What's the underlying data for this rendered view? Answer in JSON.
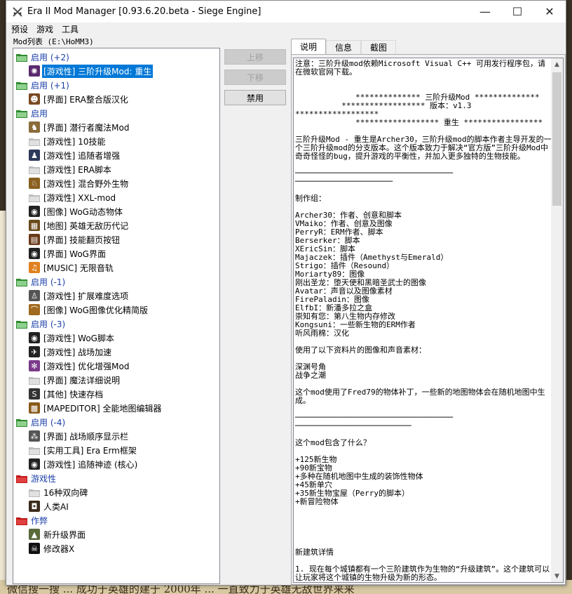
{
  "window": {
    "title": "Era II Mod Manager [0.93.6.20.beta - Siege Engine]",
    "controls": {
      "minimize": "—",
      "maximize": "☐",
      "close": "✕"
    }
  },
  "menu": [
    "预设",
    "游戏",
    "工具"
  ],
  "mod_list_label": "Mod列表 (E:\\HoMM3)",
  "tree": [
    {
      "kind": "group",
      "color": "#2e8b2e",
      "label": "启用 (+2)"
    },
    {
      "kind": "item",
      "icon": "gear-eye-icon",
      "iconColor": "#5b2a6e",
      "label": "[游戏性] 三阶升级Mod: 重生",
      "selected": true
    },
    {
      "kind": "group",
      "color": "#2e8b2e",
      "label": "启用 (+1)"
    },
    {
      "kind": "item",
      "icon": "hero-portrait-icon",
      "iconColor": "#7a4a22",
      "label": "[界面] ERA整合版汉化"
    },
    {
      "kind": "group",
      "color": "#2e8b2e",
      "label": "启用"
    },
    {
      "kind": "item",
      "icon": "creature-icon",
      "iconColor": "#8a6b3a",
      "label": "[界面] 潜行者魔法Mod"
    },
    {
      "kind": "item",
      "icon": "folder-icon",
      "iconColor": "#bdbdbd",
      "label": "[游戏性] 10技能"
    },
    {
      "kind": "item",
      "icon": "wizard-icon",
      "iconColor": "#2e3a5a",
      "label": "[游戏性] 追随者增强"
    },
    {
      "kind": "item",
      "icon": "folder-icon",
      "iconColor": "#bdbdbd",
      "label": "[游戏性] ERA脚本"
    },
    {
      "kind": "item",
      "icon": "beast-icon",
      "iconColor": "#8a6020",
      "label": "[游戏性] 混合野外生物"
    },
    {
      "kind": "item",
      "icon": "folder-icon",
      "iconColor": "#bdbdbd",
      "label": "[游戏性] XXL-mod"
    },
    {
      "kind": "item",
      "icon": "wog-eye-icon",
      "iconColor": "#222222",
      "label": "[图像] WoG动态物体"
    },
    {
      "kind": "item",
      "icon": "map-icon",
      "iconColor": "#6a4a1a",
      "label": "[地图] 英雄无敌历代记"
    },
    {
      "kind": "item",
      "icon": "book-icon",
      "iconColor": "#6a3a1a",
      "label": "[界面] 技能翻页按钮"
    },
    {
      "kind": "item",
      "icon": "wog-eye-icon",
      "iconColor": "#222222",
      "label": "[界面] WoG界面"
    },
    {
      "kind": "item",
      "icon": "music-icon",
      "iconColor": "#e08020",
      "label": "[MUSIC] 无限音轨"
    },
    {
      "kind": "group",
      "color": "#2e8b2e",
      "label": "启用 (-1)"
    },
    {
      "kind": "item",
      "icon": "figure-icon",
      "iconColor": "#555555",
      "label": "[游戏性] 扩展难度选项"
    },
    {
      "kind": "item",
      "icon": "bridge-icon",
      "iconColor": "#a06a20",
      "label": "[图像] WoG图像优化精简版"
    },
    {
      "kind": "group",
      "color": "#2e8b2e",
      "label": "启用 (-3)"
    },
    {
      "kind": "item",
      "icon": "wog-eye-icon",
      "iconColor": "#222222",
      "label": "[游戏性] WoG脚本"
    },
    {
      "kind": "item",
      "icon": "runner-icon",
      "iconColor": "#222222",
      "label": "[游戏性] 战场加速"
    },
    {
      "kind": "item",
      "icon": "gears-icon",
      "iconColor": "#7a3a8a",
      "label": "[游戏性] 优化增强Mod"
    },
    {
      "kind": "item",
      "icon": "folder-icon",
      "iconColor": "#bdbdbd",
      "label": "[界面] 魔法详细说明"
    },
    {
      "kind": "item",
      "icon": "save-icon",
      "iconColor": "#333333",
      "label": "[其他] 快速存档"
    },
    {
      "kind": "item",
      "icon": "map-editor-icon",
      "iconColor": "#8a5a1a",
      "label": "[MAPEDITOR] 全能地图编辑器"
    },
    {
      "kind": "group",
      "color": "#2e8b2e",
      "label": "启用 (-4)"
    },
    {
      "kind": "item",
      "icon": "units-icon",
      "iconColor": "#555555",
      "label": "[界面] 战场顺序显示栏"
    },
    {
      "kind": "item",
      "icon": "folder-icon",
      "iconColor": "#bdbdbd",
      "label": "[实用工具] Era Erm框架"
    },
    {
      "kind": "item",
      "icon": "wog-eye-icon",
      "iconColor": "#222222",
      "label": "[游戏性] 追随神迹 (核心)"
    },
    {
      "kind": "group",
      "color": "#c01818",
      "label": "游戏性"
    },
    {
      "kind": "item",
      "icon": "folder-icon",
      "iconColor": "#bdbdbd",
      "label": "16种双向碑"
    },
    {
      "kind": "item",
      "icon": "ai-icon",
      "iconColor": "#3a2a1a",
      "label": "人类AI"
    },
    {
      "kind": "group",
      "color": "#c01818",
      "label": "作弊"
    },
    {
      "kind": "item",
      "icon": "upgrade-icon",
      "iconColor": "#5a6a3a",
      "label": "新升级界面"
    },
    {
      "kind": "item",
      "icon": "skull-icon",
      "iconColor": "#111111",
      "label": "修改器X"
    }
  ],
  "buttons": {
    "move_up": "上移",
    "move_down": "下移",
    "disable": "禁用"
  },
  "tabs": [
    "说明",
    "信息",
    "截图"
  ],
  "description": "注意：三阶升级mod依赖Microsoft Visual C++ 可用发行程序包，请在微软官网下载。\n\n\n             ************** 三阶升级Mod **************\n          ****************** 版本：v1.3\n******************\n             ****************** 重生 *****************\n\n三阶升级Mod - 重生是Archer30，三阶升级mod的脚本作者主导开发的一个三阶升级mod的分支版本。这个版本致力于解决“官方版”三阶升级Mod中奇奇怪怪的bug，提升游戏的平衡性，并加入更多独特的生物技能。\n\n──────────────────────────────────\n─────────────────────\n\n制作组：\n\nArcher30：作者、创意和脚本\nVMaiko：作者、创意及图像\nPerryR：ERM作者、脚本\nBerserker：脚本\nXEricSin：脚本\nMajaczek：插件（Amethyst与Emerald）\nStrigo：插件（Resound）\nMoriarty89：图像\n刚出圣龙：堕天使和黑暗圣武士的图像\nAvatar：声音以及图像素材\nFirePaladin：图像\nElfbI：新潘多拉之盒\n崇知有您：第八生物内存修改\nKongsuni：一些新生物的ERM作者\n听风雨棉：汉化\n\n使用了以下资料片的图像和声音素材：\n\n深渊号角\n战争之潮\n\n这个mod使用了Fred79的物体补丁，一些新的地图物体会在随机地图中生成。\n\n──────────────────────────────────\n─────────────────────────\n\n这个mod包含了什么？\n\n+125新生物\n+90新宝物\n+多种在随机地图中生成的装饰性物体\n+45新单穴\n+35新生物宝屋（Perry的脚本）\n+新冒险物体\n\n\n\n\n\n新建筑详情\n\n1. 现在每个城镇都有一个三阶建筑作为生物的“升级建筑”。这个建筑可以让玩家将这个城镇的生物升级为新的形态。",
  "background": {
    "bottom_text": "微信搜一搜   ...   成功于英雄的建于 2000年   ...   一直致力于英雄无敌世界来来"
  }
}
